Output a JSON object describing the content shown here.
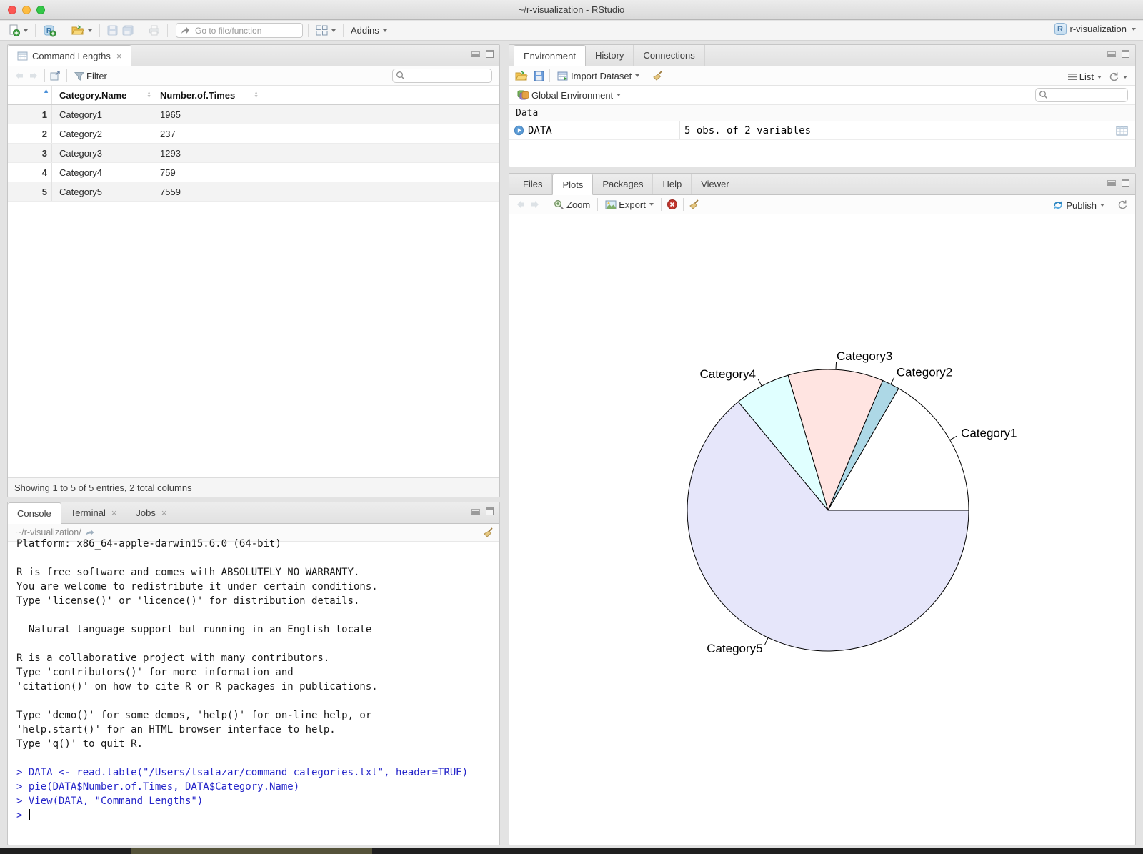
{
  "window": {
    "title": "~/r-visualization - RStudio"
  },
  "toolbar": {
    "goto_placeholder": "Go to file/function",
    "addins_label": "Addins",
    "project_label": "r-visualization"
  },
  "data_viewer": {
    "tab_title": "Command Lengths",
    "filter_label": "Filter",
    "columns": [
      "Category.Name",
      "Number.of.Times"
    ],
    "rows": [
      {
        "num": "1",
        "name": "Category1",
        "times": "1965"
      },
      {
        "num": "2",
        "name": "Category2",
        "times": "237"
      },
      {
        "num": "3",
        "name": "Category3",
        "times": "1293"
      },
      {
        "num": "4",
        "name": "Category4",
        "times": "759"
      },
      {
        "num": "5",
        "name": "Category5",
        "times": "7559"
      }
    ],
    "status": "Showing 1 to 5 of 5 entries, 2 total columns"
  },
  "environment": {
    "tabs": [
      "Environment",
      "History",
      "Connections"
    ],
    "import_label": "Import Dataset",
    "list_label": "List",
    "scope_label": "Global Environment",
    "section_label": "Data",
    "object_name": "DATA",
    "object_desc": "5 obs. of 2 variables"
  },
  "plots": {
    "tabs": [
      "Files",
      "Plots",
      "Packages",
      "Help",
      "Viewer"
    ],
    "zoom_label": "Zoom",
    "export_label": "Export",
    "publish_label": "Publish"
  },
  "console": {
    "tabs": [
      "Console",
      "Terminal",
      "Jobs"
    ],
    "path": "~/r-visualization/",
    "lines": [
      {
        "text": "Platform: x86_64-apple-darwin15.6.0 (64-bit)",
        "type": "out"
      },
      {
        "text": "",
        "type": "out"
      },
      {
        "text": "R is free software and comes with ABSOLUTELY NO WARRANTY.",
        "type": "out"
      },
      {
        "text": "You are welcome to redistribute it under certain conditions.",
        "type": "out"
      },
      {
        "text": "Type 'license()' or 'licence()' for distribution details.",
        "type": "out"
      },
      {
        "text": "",
        "type": "out"
      },
      {
        "text": "  Natural language support but running in an English locale",
        "type": "out"
      },
      {
        "text": "",
        "type": "out"
      },
      {
        "text": "R is a collaborative project with many contributors.",
        "type": "out"
      },
      {
        "text": "Type 'contributors()' for more information and",
        "type": "out"
      },
      {
        "text": "'citation()' on how to cite R or R packages in publications.",
        "type": "out"
      },
      {
        "text": "",
        "type": "out"
      },
      {
        "text": "Type 'demo()' for some demos, 'help()' for on-line help, or",
        "type": "out"
      },
      {
        "text": "'help.start()' for an HTML browser interface to help.",
        "type": "out"
      },
      {
        "text": "Type 'q()' to quit R.",
        "type": "out"
      },
      {
        "text": "",
        "type": "out"
      },
      {
        "text": "> DATA <- read.table(\"/Users/lsalazar/command_categories.txt\", header=TRUE)",
        "type": "in"
      },
      {
        "text": "> pie(DATA$Number.of.Times, DATA$Category.Name)",
        "type": "in"
      },
      {
        "text": "> View(DATA, \"Command Lengths\")",
        "type": "in"
      },
      {
        "text": "> ",
        "type": "in",
        "cursor": true
      }
    ]
  },
  "chart_data": {
    "type": "pie",
    "categories": [
      "Category1",
      "Category2",
      "Category3",
      "Category4",
      "Category5"
    ],
    "values": [
      1965,
      237,
      1293,
      759,
      7559
    ],
    "colors": [
      "#ffffff",
      "#add8e6",
      "#ffe4e1",
      "#e0ffff",
      "#e6e6fa"
    ],
    "start_angle_deg": 0,
    "direction": "counterclockwise",
    "stroke": "#000000",
    "title": "",
    "legend": "none"
  }
}
